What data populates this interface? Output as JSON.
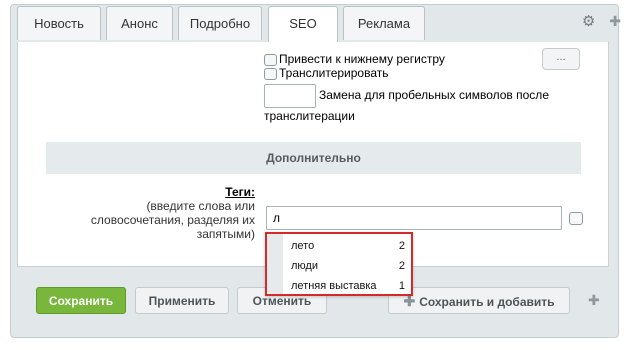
{
  "tabs": [
    {
      "label": "Новость"
    },
    {
      "label": "Анонс"
    },
    {
      "label": "Подробно"
    },
    {
      "label": "SEO"
    },
    {
      "label": "Реклама"
    }
  ],
  "options": {
    "lowercase_label": "Привести к нижнему регистру",
    "transliterate_label": "Транслитерировать",
    "space_replace_label": "Замена для пробельных символов после",
    "space_replace_label_2": "транслитерации",
    "dots_button": "..."
  },
  "section": {
    "title": "Дополнительно"
  },
  "tags": {
    "label": "Теги:",
    "hint_1": "(введите слова или",
    "hint_2": "словосочетания, разделяя их",
    "hint_3": "запятыми)",
    "value": "л"
  },
  "suggestions": [
    {
      "text": "лето",
      "count": "2"
    },
    {
      "text": "люди",
      "count": "2"
    },
    {
      "text": "летняя выставка",
      "count": "1"
    }
  ],
  "buttons": {
    "save": "Сохранить",
    "apply": "Применить",
    "cancel": "Отменить",
    "save_add": "Сохранить и добавить"
  },
  "icons": {
    "settings": "gear-icon",
    "pin": "pin-icon",
    "plus": "plus-icon"
  },
  "colors": {
    "save_button": "#78b73c",
    "highlight_border": "#d22b2b"
  }
}
